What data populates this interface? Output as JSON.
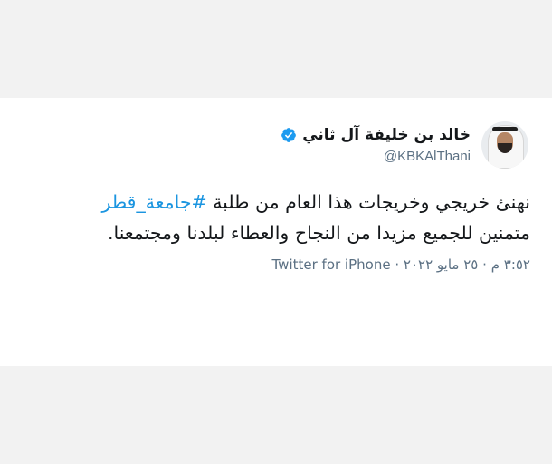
{
  "tweet": {
    "display_name": "خالد بن خليفة آل ثاني",
    "handle": "@KBKAlThani",
    "text_line1": "نهنئ خريجي وخريجات هذا العام من طلبة ",
    "hashtag": "#جامعة_قطر",
    "text_line2": "متمنين للجميع مزيدا من النجاح والعطاء لبلدنا ومجتمعنا.",
    "time": "٣:٥٢ م",
    "separator": "·",
    "date": "٢٥ مايو ٢٠٢٢",
    "source": "Twitter for iPhone",
    "colors": {
      "hashtag": "#1b95e0",
      "verified": "#1d9bf0",
      "muted": "#5b7083"
    },
    "icons": [
      "avatar",
      "verified-badge-icon"
    ]
  }
}
